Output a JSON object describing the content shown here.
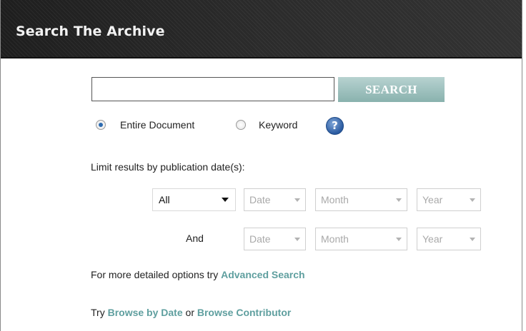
{
  "header": {
    "title": "Search The Archive"
  },
  "search": {
    "value": "",
    "placeholder": "",
    "button_label": "SEARCH"
  },
  "scope": {
    "options": [
      {
        "label": "Entire Document",
        "checked": true
      },
      {
        "label": "Keyword",
        "checked": false
      }
    ],
    "help_icon": "?"
  },
  "date_filter": {
    "label": "Limit results by publication date(s):",
    "mode_select": {
      "value": "All"
    },
    "row1": {
      "date": "Date",
      "month": "Month",
      "year": "Year"
    },
    "and_label": "And",
    "row2": {
      "date": "Date",
      "month": "Month",
      "year": "Year"
    }
  },
  "advanced": {
    "prefix": "For more detailed options try ",
    "link": "Advanced Search"
  },
  "browse": {
    "prefix": "Try ",
    "link1": "Browse by Date",
    "middle": " or ",
    "link2": "Browse Contributor"
  },
  "colors": {
    "link": "#5f9f9f",
    "button": "#89b2ae",
    "header_bg": "#222222"
  },
  "icons": {
    "help": "question-circle-icon",
    "dropdown": "chevron-down-icon"
  }
}
